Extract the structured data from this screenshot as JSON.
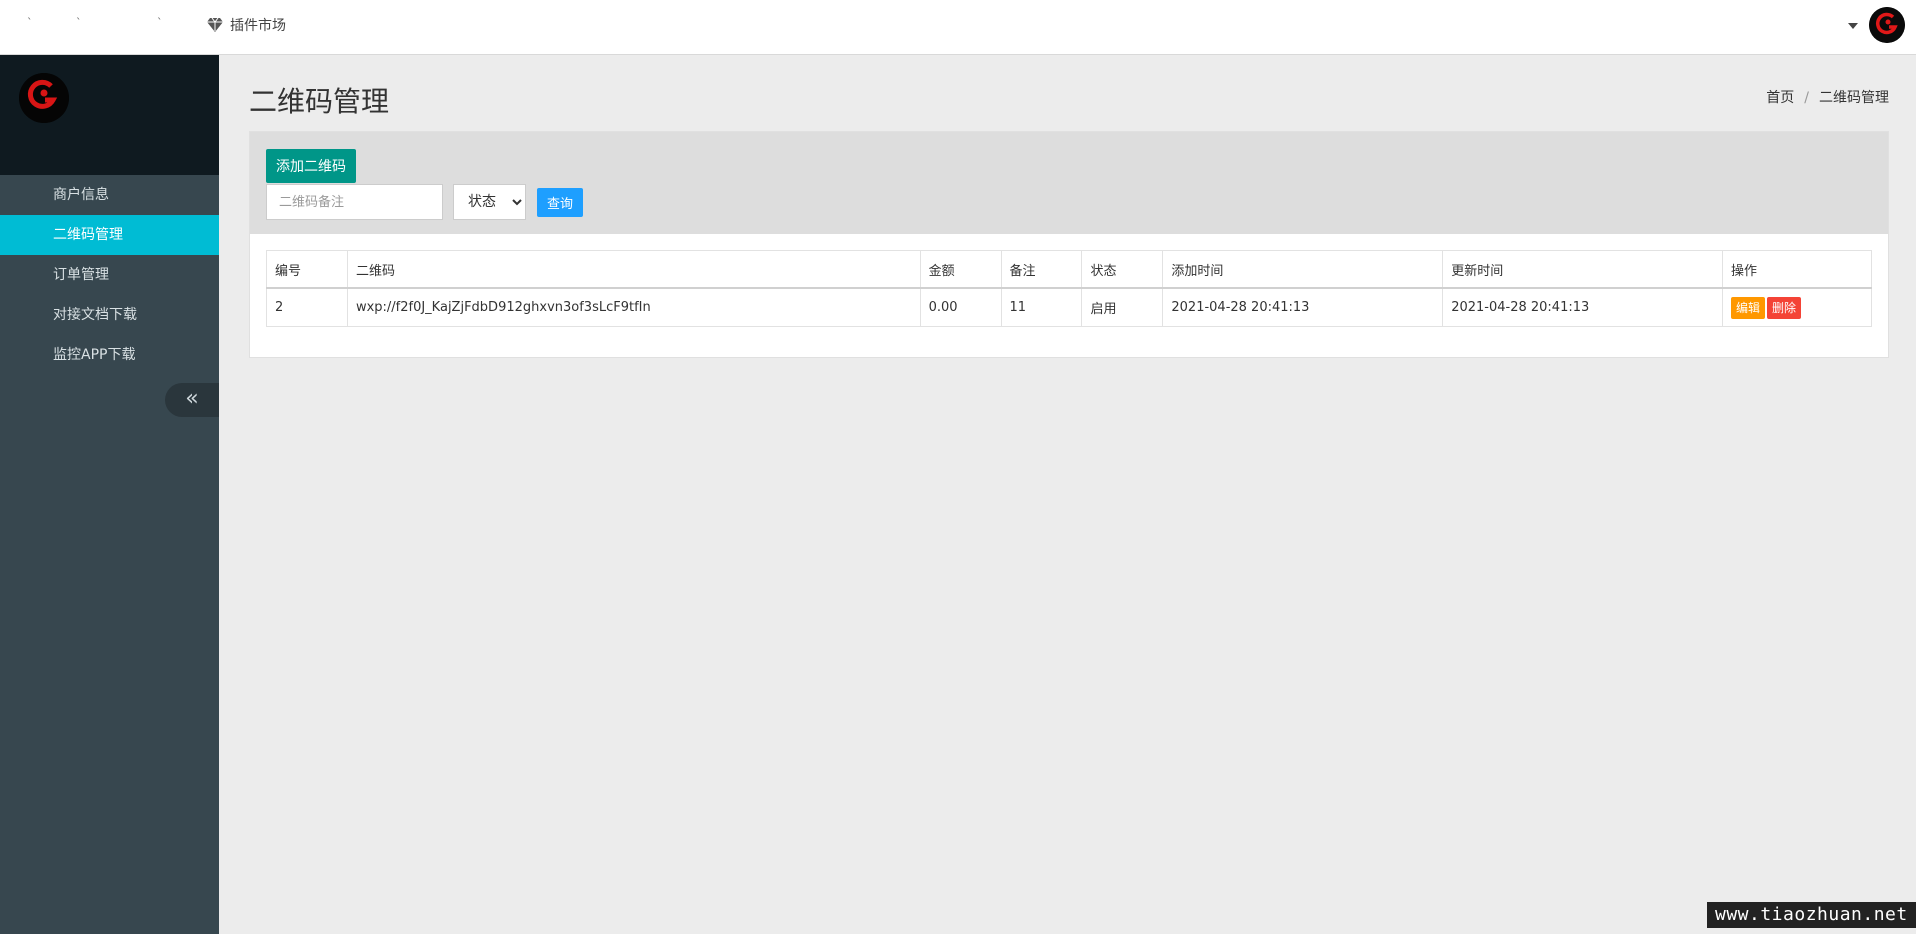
{
  "topbar": {
    "plugin_market": "插件市场"
  },
  "sidebar": {
    "items": [
      {
        "label": "商户信息",
        "active": false
      },
      {
        "label": "二维码管理",
        "active": true
      },
      {
        "label": "订单管理",
        "active": false
      },
      {
        "label": "对接文档下载",
        "active": false
      },
      {
        "label": "监控APP下载",
        "active": false
      }
    ],
    "collapse_icon": "double-chevron-left-icon"
  },
  "page": {
    "title": "二维码管理",
    "breadcrumb_home": "首页",
    "breadcrumb_sep": "/",
    "breadcrumb_current": "二维码管理"
  },
  "toolbar": {
    "add_label": "添加二维码",
    "search_placeholder": "二维码备注",
    "status_selected": "状态",
    "query_label": "查询"
  },
  "table": {
    "headers": [
      "编号",
      "二维码",
      "金额",
      "备注",
      "状态",
      "添加时间",
      "更新时间",
      "操作"
    ],
    "rows": [
      {
        "id": "2",
        "qrcode": "wxp://f2f0J_KajZjFdbD912ghxvn3of3sLcF9tfIn",
        "amount": "0.00",
        "note": "11",
        "status": "启用",
        "created": "2021-04-28 20:41:13",
        "updated": "2021-04-28 20:41:13",
        "edit_label": "编辑",
        "delete_label": "删除"
      }
    ]
  },
  "colors": {
    "sidebar_bg": "#37474f",
    "active_accent": "#00bcd4",
    "add_button": "#009688",
    "query_button": "#1e9fff",
    "edit_button": "#ff9800",
    "delete_button": "#f44336"
  },
  "watermark": "www.tiaozhuan.net"
}
